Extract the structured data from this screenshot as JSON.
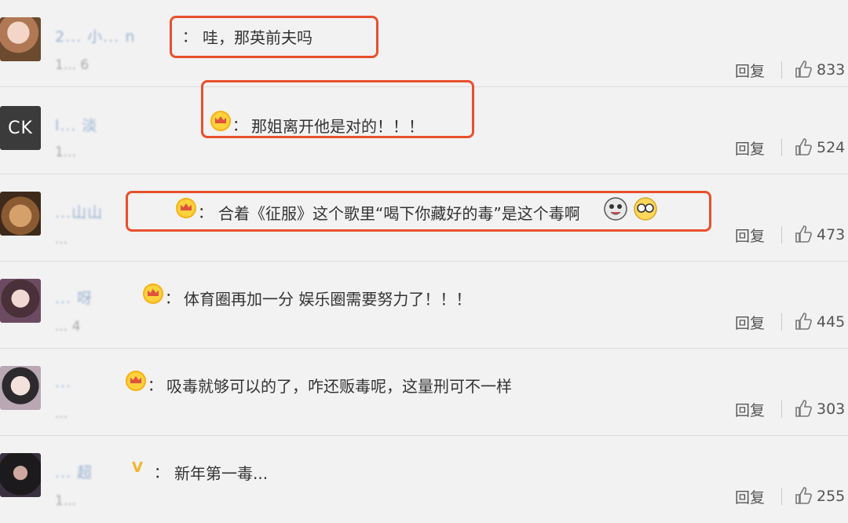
{
  "comments": [
    {
      "username": "2... 小... n",
      "badge": "",
      "colon": "：",
      "text": "哇，那英前夫吗",
      "time": "1... 6",
      "reply": "回复",
      "likes": "833",
      "avatar": "avatar-photo",
      "avatar_text": ""
    },
    {
      "username": "l... 淡",
      "badge": "crown",
      "colon": "：",
      "text": "那姐离开他是对的！！！",
      "time": "1...",
      "reply": "回复",
      "likes": "524",
      "avatar": "avatar-text",
      "avatar_text": "CK"
    },
    {
      "username": "...山山",
      "badge": "crown",
      "colon": "：",
      "text": "合着《征服》这个歌里“喝下你藏好的毒”是这个毒啊",
      "time": "...",
      "reply": "回复",
      "likes": "473",
      "avatar": "avatar-photo",
      "avatar_text": ""
    },
    {
      "username": "... 呀",
      "badge": "crown",
      "colon": "：",
      "text": "体育圈再加一分 娱乐圈需要努力了！！！",
      "time": "... 4",
      "reply": "回复",
      "likes": "445",
      "avatar": "avatar-photo",
      "avatar_text": ""
    },
    {
      "username": "...",
      "badge": "crown",
      "colon": "：",
      "text": "吸毒就够可以的了，咋还贩毒呢，这量刑可不一样",
      "time": "...",
      "reply": "回复",
      "likes": "303",
      "avatar": "avatar-photo",
      "avatar_text": ""
    },
    {
      "username": "... 超",
      "badge": "v",
      "colon": "：",
      "text": "新年第一毒...",
      "time": "1...",
      "reply": "回复",
      "likes": "255",
      "avatar": "avatar-photo",
      "avatar_text": ""
    }
  ],
  "colors": {
    "highlight": "#e8502d",
    "username": "#8aa6cc",
    "background": "#f2f2f2"
  },
  "icons": {
    "like": "thumbs-up-icon",
    "vip": "crown-icon",
    "verified": "v-badge-icon"
  }
}
